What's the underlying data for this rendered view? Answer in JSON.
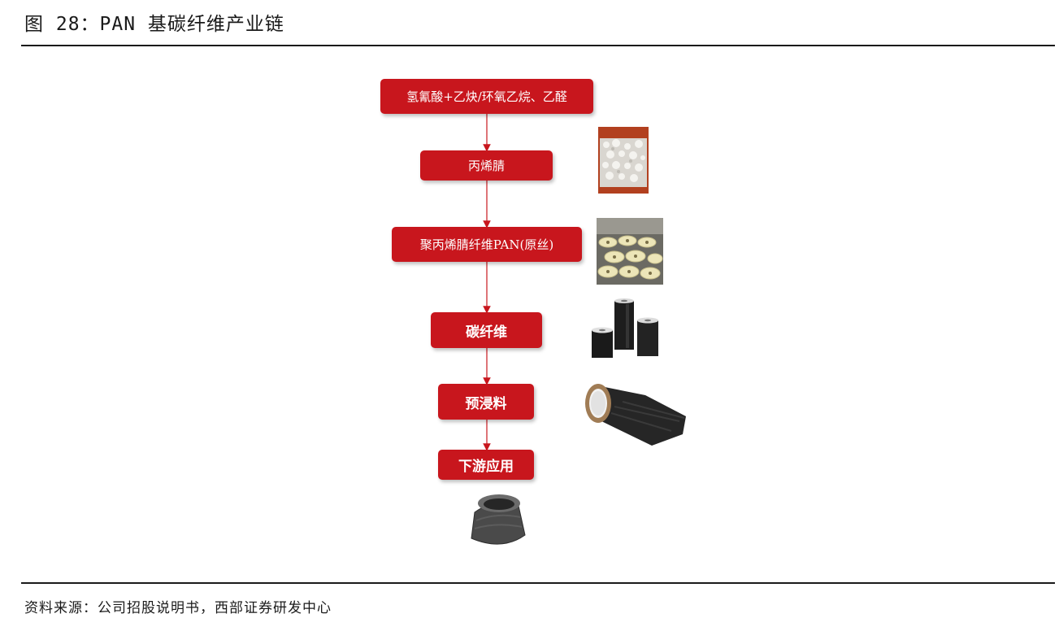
{
  "figure": {
    "title": "图 28：PAN 基碳纤维产业链",
    "source": "资料来源：公司招股说明书，西部证券研发中心"
  },
  "chain": {
    "steps": [
      "氢氰酸+乙炔/环氧乙烷、乙醛",
      "丙烯腈",
      "聚丙烯腈纤维PAN(原丝)",
      "碳纤维",
      "预浸料",
      "下游应用"
    ]
  },
  "colors": {
    "box_fill": "#c8161d",
    "box_text": "#ffffff",
    "arrow": "#c8161d",
    "rule": "#1a1a1a"
  }
}
